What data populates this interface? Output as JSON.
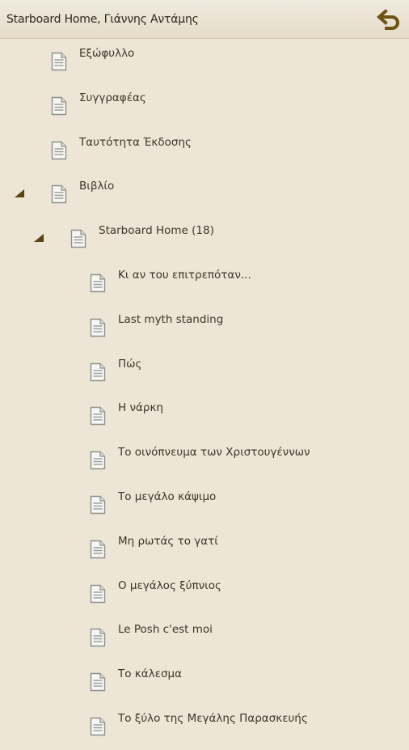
{
  "header": {
    "title": "Starboard Home, Γιάννης Αντάμης",
    "back_icon": "undo-arrow-icon",
    "accent": "#6e5410"
  },
  "tree": {
    "items": [
      {
        "label": "Εξώφυλλο",
        "level": 0,
        "expanded": null
      },
      {
        "label": "Συγγραφέας",
        "level": 0,
        "expanded": null
      },
      {
        "label": "Ταυτότητα Έκδοσης",
        "level": 0,
        "expanded": null
      },
      {
        "label": "Βιβλίο",
        "level": 0,
        "expanded": true
      },
      {
        "label": "Starboard Home (18)",
        "level": 1,
        "expanded": true
      },
      {
        "label": "Κι αν του επιτρεπόταν...",
        "level": 2,
        "expanded": null
      },
      {
        "label": "Last myth standing",
        "level": 2,
        "expanded": null
      },
      {
        "label": "Πώς",
        "level": 2,
        "expanded": null
      },
      {
        "label": "Η νάρκη",
        "level": 2,
        "expanded": null
      },
      {
        "label": "Το οινόπνευμα των Χριστουγέννων",
        "level": 2,
        "expanded": null
      },
      {
        "label": "Το μεγάλο κάψιμο",
        "level": 2,
        "expanded": null
      },
      {
        "label": "Μη ρωτάς το γατί",
        "level": 2,
        "expanded": null
      },
      {
        "label": "Ο μεγάλος ξύπνιος",
        "level": 2,
        "expanded": null
      },
      {
        "label": "Le Posh c'est moi",
        "level": 2,
        "expanded": null
      },
      {
        "label": "Το κάλεσμα",
        "level": 2,
        "expanded": null
      },
      {
        "label": "Το ξύλο της Μεγάλης Παρασκευής",
        "level": 2,
        "expanded": null
      }
    ]
  }
}
